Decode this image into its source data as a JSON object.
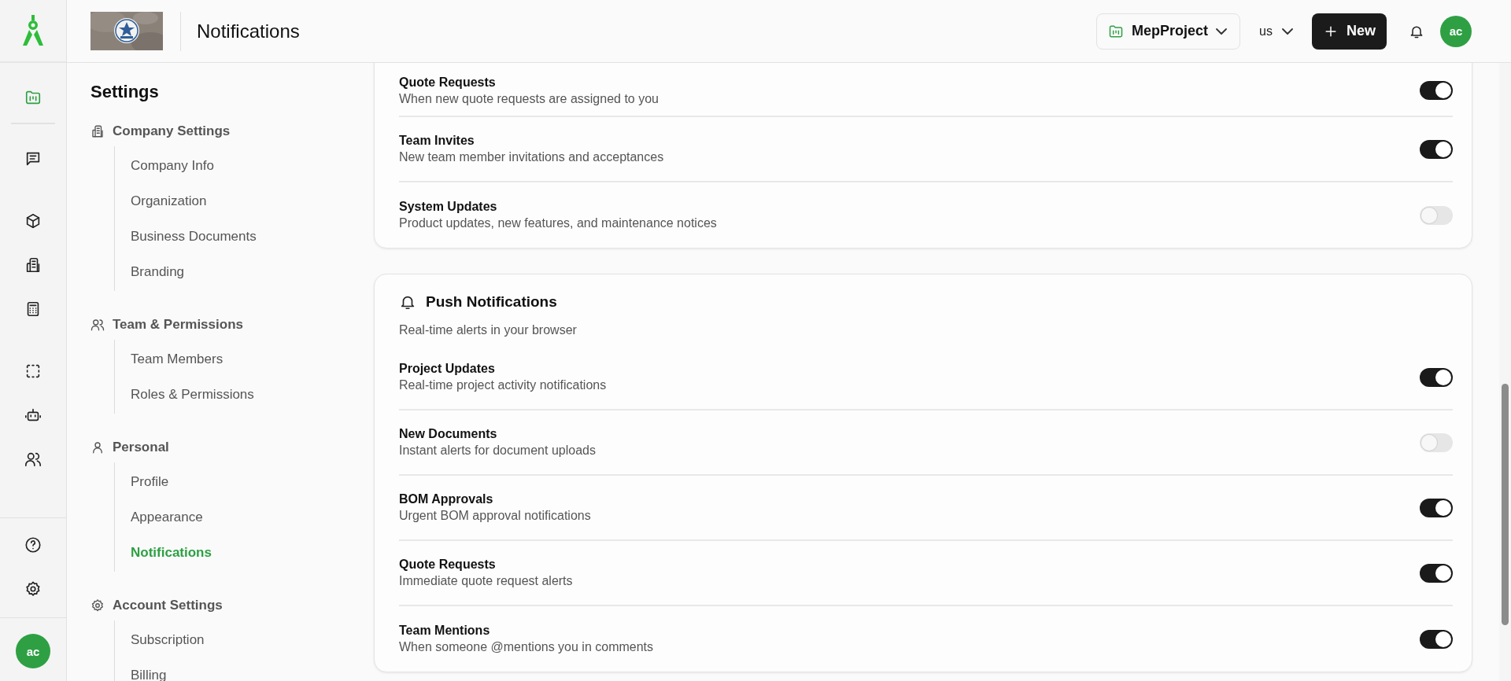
{
  "rail": {
    "items": [
      {
        "selected": true
      },
      {
        "selected": false
      },
      {
        "selected": false
      },
      {
        "selected": false
      },
      {
        "selected": false
      },
      {
        "selected": false
      },
      {
        "selected": false
      },
      {
        "selected": false
      },
      {
        "selected": false
      },
      {
        "selected": false
      }
    ],
    "avatar": "ac"
  },
  "header": {
    "title": "Notifications",
    "project": "MepProject",
    "region": "us",
    "new_button": "New",
    "avatar": "ac"
  },
  "sidebar": {
    "title": "Settings",
    "sections": [
      {
        "label": "Company Settings",
        "items": [
          {
            "label": "Company Info",
            "selected": false
          },
          {
            "label": "Organization",
            "selected": false
          },
          {
            "label": "Business Documents",
            "selected": false
          },
          {
            "label": "Branding",
            "selected": false
          }
        ]
      },
      {
        "label": "Team & Permissions",
        "items": [
          {
            "label": "Team Members",
            "selected": false
          },
          {
            "label": "Roles & Permissions",
            "selected": false
          }
        ]
      },
      {
        "label": "Personal",
        "items": [
          {
            "label": "Profile",
            "selected": false
          },
          {
            "label": "Appearance",
            "selected": false
          },
          {
            "label": "Notifications",
            "selected": true
          }
        ]
      },
      {
        "label": "Account Settings",
        "items": [
          {
            "label": "Subscription",
            "selected": false
          },
          {
            "label": "Billing",
            "selected": false
          }
        ]
      }
    ]
  },
  "email_card": {
    "rows": [
      {
        "title": "Quote Requests",
        "description": "When new quote requests are assigned to you",
        "on": true
      },
      {
        "title": "Team Invites",
        "description": "New team member invitations and acceptances",
        "on": true
      },
      {
        "title": "System Updates",
        "description": "Product updates, new features, and maintenance notices",
        "on": false
      }
    ]
  },
  "push_card": {
    "title": "Push Notifications",
    "subtitle": "Real-time alerts in your browser",
    "rows": [
      {
        "title": "Project Updates",
        "description": "Real-time project activity notifications",
        "on": true
      },
      {
        "title": "New Documents",
        "description": "Instant alerts for document uploads",
        "on": false
      },
      {
        "title": "BOM Approvals",
        "description": "Urgent BOM approval notifications",
        "on": true
      },
      {
        "title": "Quote Requests",
        "description": "Immediate quote request alerts",
        "on": true
      },
      {
        "title": "Team Mentions",
        "description": "When someone @mentions you in comments",
        "on": true
      }
    ]
  }
}
